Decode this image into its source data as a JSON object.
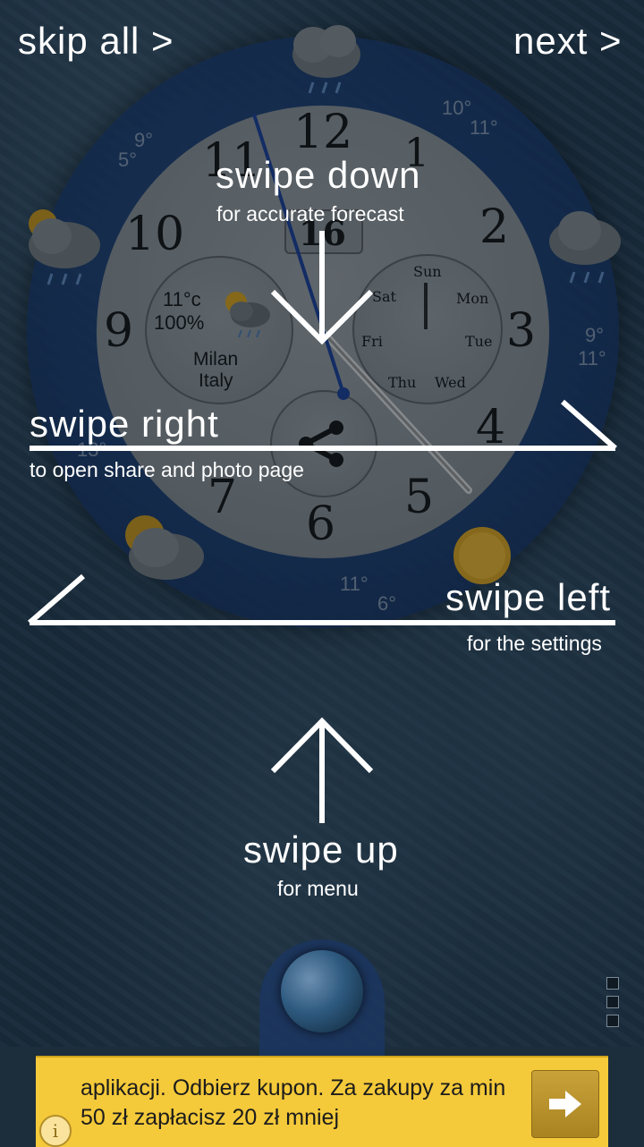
{
  "topbar": {
    "skip_label": "skip all >",
    "next_label": "next >"
  },
  "clock": {
    "numerals": [
      "12",
      "1",
      "2",
      "3",
      "4",
      "5",
      "6",
      "7",
      "8",
      "9",
      "10",
      "11"
    ],
    "date_window": "16",
    "weather_subdial": {
      "temp": "11°c",
      "humidity": "100%",
      "city": "Milan",
      "country": "Italy"
    },
    "weekday_subdial": [
      "Sun",
      "Mon",
      "Tue",
      "Wed",
      "Thu",
      "Fri",
      "Sat"
    ]
  },
  "temps": {
    "t1": "10°",
    "t2": "11°",
    "t3": "9°",
    "t4": "5°",
    "t5": "9°",
    "t6": "11°",
    "t7": "11°",
    "t8": "6°",
    "t9": "13°"
  },
  "hints": {
    "down": {
      "title": "swipe down",
      "sub": "for accurate forecast"
    },
    "right": {
      "title": "swipe right",
      "sub": "to open share and photo page"
    },
    "left": {
      "title": "swipe left",
      "sub": "for the settings"
    },
    "up": {
      "title": "swipe up",
      "sub": "for menu"
    }
  },
  "ad": {
    "text": "aplikacji. Odbierz kupon. Za zakupy za min 50 zł zapłacisz 20 zł mniej",
    "info_symbol": "i"
  },
  "icons": [
    "cloud-rain-icon",
    "sun-icon",
    "globe-icon",
    "share-icon",
    "arrow-right-icon",
    "info-icon",
    "more-icon"
  ]
}
